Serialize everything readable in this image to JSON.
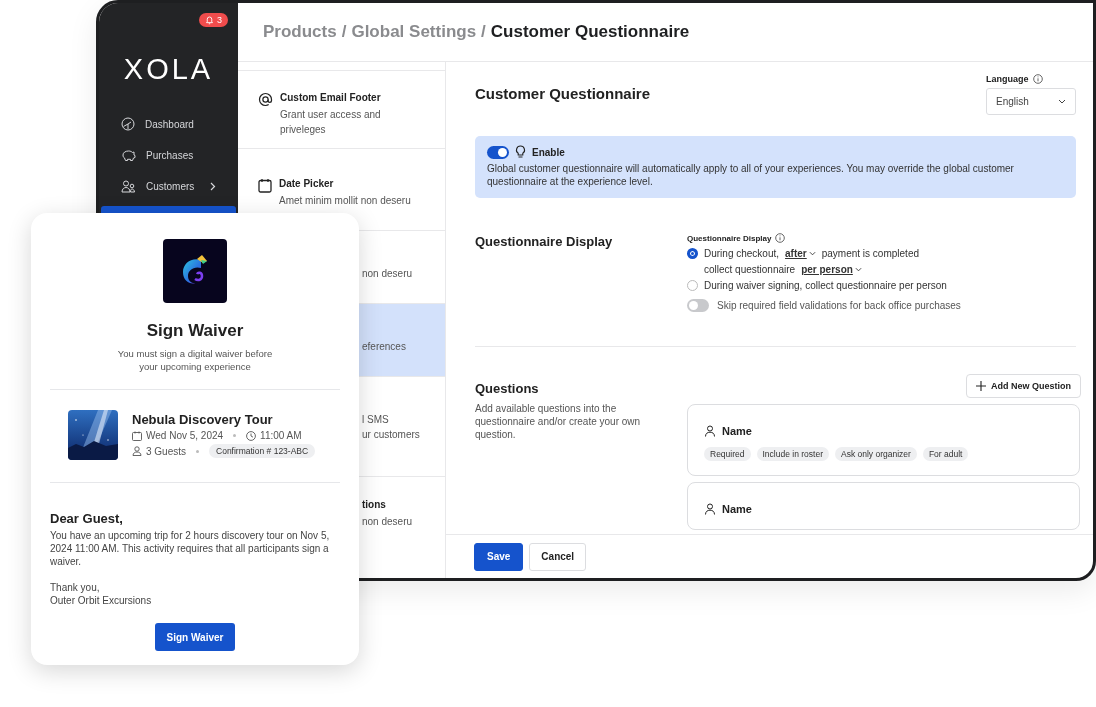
{
  "sidebar": {
    "notification_count": "3",
    "logo": "XOLA",
    "items": [
      {
        "kind": "dashboard",
        "label": "Dashboard",
        "has_submenu": false,
        "selected": false
      },
      {
        "kind": "purchases",
        "label": "Purchases",
        "has_submenu": false,
        "selected": false
      },
      {
        "kind": "customers",
        "label": "Customers",
        "has_submenu": true,
        "selected": false
      },
      {
        "kind": "products",
        "selected": true
      }
    ]
  },
  "header": {
    "separator": "/",
    "breadcrumb": [
      {
        "label": "Products",
        "current": false
      },
      {
        "label": "Global Settings",
        "current": false
      },
      {
        "label": "Customer Questionnaire",
        "current": true
      }
    ]
  },
  "settings_list": [
    {
      "kind": "email",
      "title": "Custom Email Footer",
      "description": [
        "Grant user access and",
        "priveleges"
      ],
      "selected": false
    },
    {
      "kind": "calendar",
      "title": "Date Picker",
      "description": [
        "Amet minim mollit non deseru"
      ],
      "selected": false
    },
    {
      "kind": "covered",
      "description": [
        "non deseru"
      ],
      "selected": false
    },
    {
      "kind": "covered",
      "description": [
        "eferences"
      ],
      "selected": true
    },
    {
      "kind": "covered",
      "description": [
        "l SMS",
        "ur customers"
      ],
      "selected": false
    },
    {
      "kind": "covered",
      "title": "tions",
      "description": [
        "non deseru"
      ],
      "selected": false
    }
  ],
  "content": {
    "title": "Customer Questionnaire",
    "language": {
      "label": "Language",
      "value": "English"
    },
    "enable": {
      "on": true,
      "label": "Enable",
      "text": "Global customer questionnaire will automatically apply to all of your experiences. You may override the global customer questionnaire at the experience level."
    },
    "display": {
      "heading": "Questionnaire Display",
      "field_label": "Questionnaire Display",
      "options": [
        {
          "selected": true,
          "segments": [
            {
              "kind": "text",
              "text": "During checkout,"
            },
            {
              "kind": "dropdown",
              "text": "after"
            },
            {
              "kind": "text",
              "text": "payment is completed"
            },
            {
              "kind": "text",
              "text": "collect questionnaire"
            },
            {
              "kind": "dropdown",
              "text": "per person"
            }
          ]
        },
        {
          "selected": false,
          "segments": [
            {
              "kind": "text",
              "text": "During waiver signing, collect questionnaire per person"
            }
          ]
        }
      ],
      "skip_toggle": {
        "on": false,
        "label": "Skip required field validations for back office purchases"
      }
    },
    "questions": {
      "heading": "Questions",
      "description": "Add available questions into the questionnaire and/or create your own question.",
      "add_button": "Add New Question",
      "items": [
        {
          "label": "Name",
          "tags": [
            "Required",
            "Include in roster",
            "Ask only organizer",
            "For adult"
          ]
        },
        {
          "label": "Name"
        }
      ]
    },
    "buttons": [
      {
        "kind": "primary",
        "label": "Save"
      },
      {
        "kind": "secondary",
        "label": "Cancel"
      }
    ]
  },
  "waiver_card": {
    "title": "Sign Waiver",
    "subtitle": "You must sign a digital waiver before your upcoming experience",
    "booking": {
      "tour": "Nebula Discovery Tour",
      "date": "Wed Nov 5, 2024",
      "time": "11:00 AM",
      "guests": "3 Guests",
      "confirmation": "Confirmation # 123-ABC"
    },
    "greeting": "Dear Guest,",
    "message": "You have an upcoming trip for 2 hours discovery tour on Nov 5, 2024 11:00 AM. This activity requires that all participants sign a waiver.",
    "signoff": [
      "Thank you,",
      "Outer Orbit Excursions"
    ],
    "button": "Sign Waiver"
  }
}
